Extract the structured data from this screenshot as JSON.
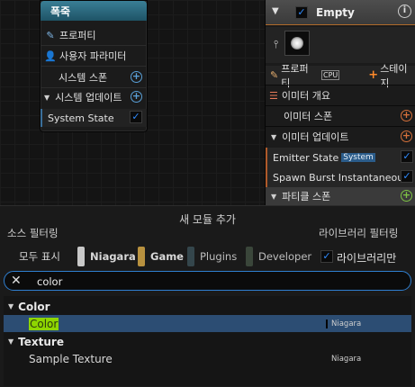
{
  "left_node": {
    "title": "폭죽",
    "rows": [
      {
        "label": "프로퍼티",
        "icon": "pencil-icon"
      },
      {
        "label": "사용자 파라미터",
        "icon": "user-icon"
      },
      {
        "label": "시스템 스폰"
      },
      {
        "label": "시스템 업데이트"
      },
      {
        "label": "System State",
        "checked": true
      }
    ]
  },
  "right_node": {
    "title": "Empty",
    "tabs": {
      "properties": "프로퍼티",
      "cpu": "CPU",
      "stage": "스테이지"
    },
    "rows": [
      {
        "label": "이미터 개요"
      },
      {
        "label": "이미터 스폰"
      },
      {
        "label": "이미터 업데이트"
      },
      {
        "label": "Emitter State",
        "badge": "System",
        "checked": true
      },
      {
        "label": "Spawn Burst Instantaneous",
        "checked": true
      },
      {
        "label": "파티클 스폰"
      }
    ]
  },
  "dialog": {
    "title": "새 모듈 추가",
    "source_filter_label": "소스 필터링",
    "library_filter_label": "라이브러리 필터링",
    "show_all": "모두 표시",
    "chips": [
      {
        "label": "Niagara",
        "color": "#c8c8c8",
        "active": true
      },
      {
        "label": "Game",
        "color": "#b8913f",
        "active": true
      },
      {
        "label": "Plugins",
        "color": "#34464c",
        "active": false
      },
      {
        "label": "Developer",
        "color": "#3a463a",
        "active": false
      }
    ],
    "library_only": "라이브러리만",
    "search_value": "color",
    "results": [
      {
        "category": "Color",
        "items": [
          {
            "name": "Color",
            "source": "Niagara",
            "selected": true
          }
        ]
      },
      {
        "category": "Texture",
        "items": [
          {
            "name": "Sample Texture",
            "source": "Niagara",
            "selected": false
          }
        ]
      }
    ]
  },
  "colors": {
    "accent_blue": "#2f8bff",
    "node_header_teal": "#2e6a80",
    "highlight_green": "#8ed600",
    "selection_blue": "#2c4d73"
  }
}
